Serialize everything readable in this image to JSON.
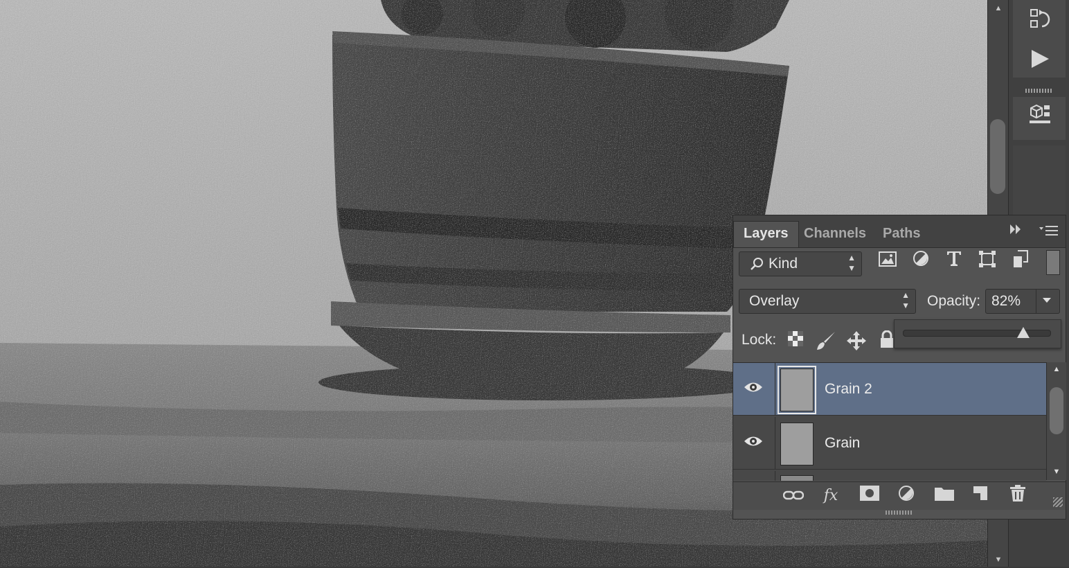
{
  "canvas": {
    "description_icon": "photo-canvas"
  },
  "vertical_scrollbar": {
    "up_arrow": "▲",
    "down_arrow": "▼"
  },
  "dock": {
    "history_icon": "history-icon",
    "actions_icon": "play-icon",
    "properties_icon": "3d-cube-icon"
  },
  "layers_panel": {
    "tabs": [
      {
        "label": "Layers",
        "active": true
      },
      {
        "label": "Channels",
        "active": false
      },
      {
        "label": "Paths",
        "active": false
      }
    ],
    "filter": {
      "kind_label": "Kind"
    },
    "blend_mode": "Overlay",
    "opacity_label": "Opacity:",
    "opacity_value": "82%",
    "opacity_fraction": 0.82,
    "lock_label": "Lock:",
    "layers": [
      {
        "name": "Grain 2",
        "selected": true,
        "visible": true
      },
      {
        "name": "Grain",
        "selected": false,
        "visible": true
      }
    ],
    "selection_color": "#5f6f88"
  }
}
